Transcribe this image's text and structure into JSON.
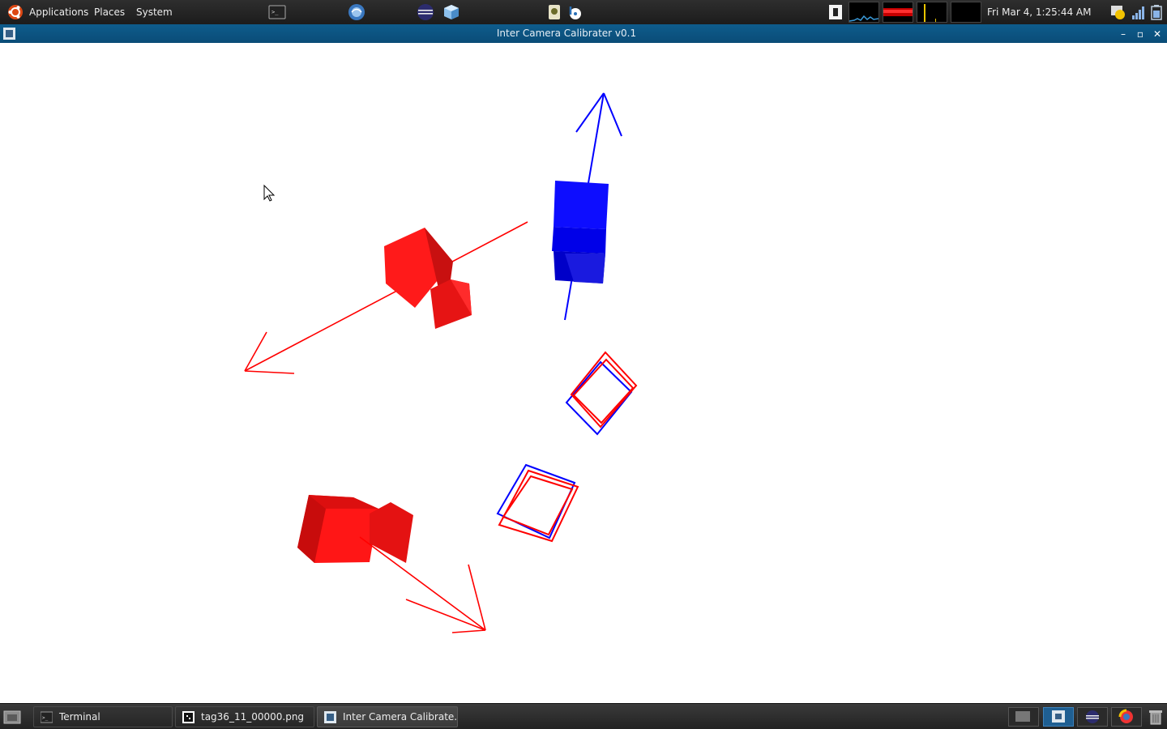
{
  "top_panel": {
    "menus": [
      "Applications",
      "Places",
      "System"
    ],
    "clock": "Fri Mar  4,  1:25:44 AM",
    "launchers": [
      "terminal-icon",
      "browser-globe-icon",
      "eclipse-icon",
      "cube-app-icon",
      "camera-app-icon",
      "brasero-icon"
    ],
    "tray": [
      "notes-icon",
      "cpu-monitor-icon",
      "memory-monitor-icon",
      "network-monitor-icon",
      "disk-monitor-icon"
    ],
    "indicators": [
      "user-status-icon",
      "signal-icon",
      "battery-icon"
    ]
  },
  "window": {
    "title": "Inter Camera Calibrater v0.1",
    "controls": [
      "minimize-icon",
      "maximize-icon",
      "close-icon"
    ]
  },
  "scene": {
    "background": "#ffffff",
    "colors": {
      "red": "#ff0000",
      "blue": "#0000ff"
    }
  },
  "bottom_panel": {
    "tasks": [
      {
        "label": "Terminal",
        "icon": "terminal-icon",
        "active": false
      },
      {
        "label": "tag36_11_00000.png",
        "icon": "image-icon",
        "active": false
      },
      {
        "label": "Inter Camera Calibrate...",
        "icon": "calibrator-icon",
        "active": true
      }
    ],
    "workspaces": [
      "workspace-1",
      "workspace-2",
      "workspace-3",
      "workspace-4"
    ]
  }
}
